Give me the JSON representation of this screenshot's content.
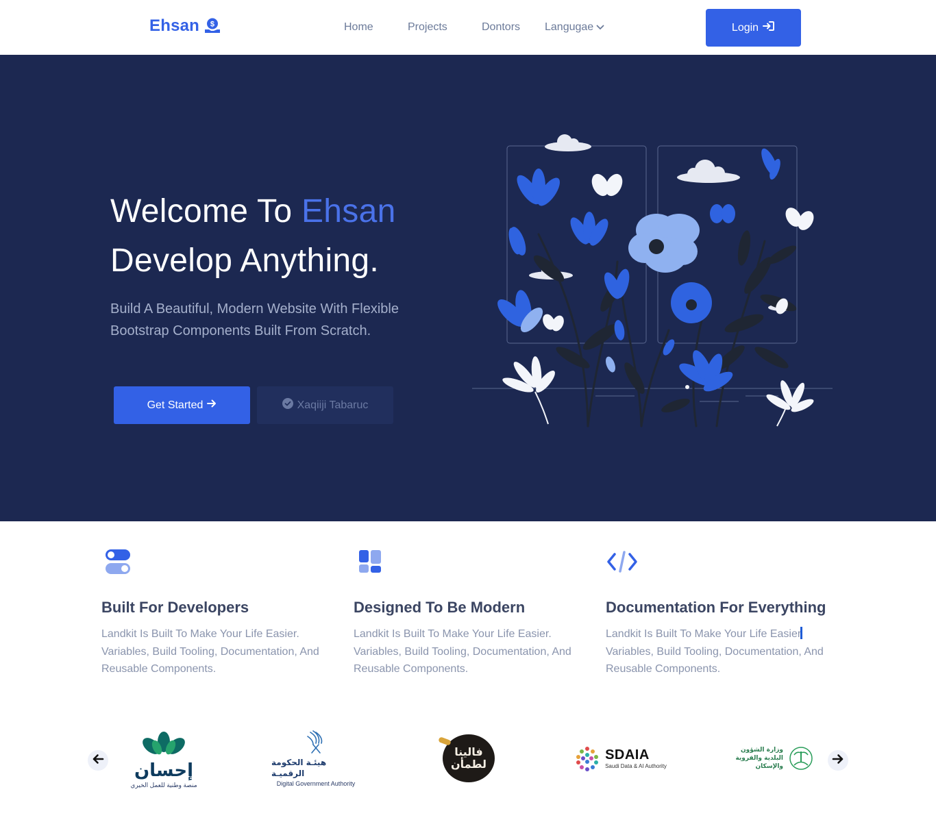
{
  "navbar": {
    "brand": "Ehsan",
    "links": [
      "Home",
      "Projects",
      "Dontors",
      "Langugae"
    ],
    "login_label": "Login"
  },
  "hero": {
    "title_prefix": "Welcome To ",
    "title_accent": "Ehsan",
    "title_line2": "Develop Anything.",
    "subtitle": "Build A Beautiful, Modern Website With Flexible Bootstrap Components Built From Scratch.",
    "primary_button": "Get Started",
    "secondary_button": "Xaqiiji Tabaruc"
  },
  "features": [
    {
      "icon": "toggle-icon",
      "title": "Built For Developers",
      "description": "Landkit Is Built To Make Your Life Easier. Variables, Build Tooling, Documentation, And Reusable Components."
    },
    {
      "icon": "layout-icon",
      "title": "Designed To Be Modern",
      "description": "Landkit Is Built To Make Your Life Easier. Variables, Build Tooling, Documentation, And Reusable Components."
    },
    {
      "icon": "code-icon",
      "title": "Documentation For Everything",
      "description_before_cursor": "Landkit Is Built To Make Your Life Easier",
      "description_after_cursor": " Variables, Build Tooling, Documentation, And Reusable Components."
    }
  ],
  "partners": [
    {
      "name": "إحسان",
      "caption": "منصة وطنية للعمل الخيري"
    },
    {
      "name": "هيئـة الحكومة الرقميـة",
      "caption": "Digital Government Authority"
    },
    {
      "name": "فالينا لطمأن",
      "caption": ""
    },
    {
      "name": "SDAIA",
      "caption": "Saudi Data & AI Authority"
    },
    {
      "name": "وزارة الشؤون البلدية والقروية والإسكان",
      "caption": ""
    }
  ],
  "colors": {
    "accent": "#3361e6",
    "hero_bg": "#1c2851",
    "muted_text": "#8a94ad"
  }
}
